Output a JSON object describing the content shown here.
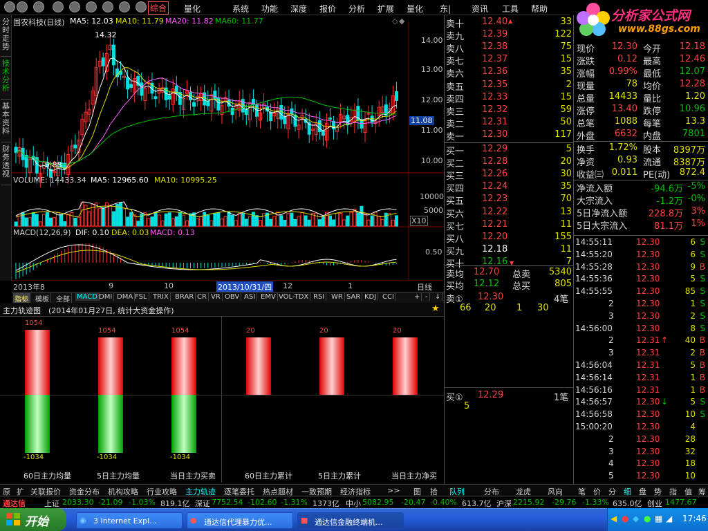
{
  "menubar": {
    "tab_active": "综合",
    "tab2": "量化",
    "items": [
      "系统",
      "功能",
      "深度",
      "报价",
      "分析",
      "扩展",
      "量化",
      "东|",
      "资讯",
      "工具",
      "帮助"
    ]
  },
  "logo": {
    "title": "分析家公式网",
    "url": "www.88gs.com"
  },
  "left_tabs": [
    "分时走势",
    "技术分析",
    "基本资料",
    "财务透视"
  ],
  "chart": {
    "title": "国农科技(日线)",
    "ma5": "MA5: 12.03",
    "ma10": "MA10: 11.79",
    "ma20": "MA20: 11.82",
    "ma60": "MA60: 11.77",
    "high_mark": "14.32",
    "low_mark": "9.88",
    "price_ticks": [
      "14.00",
      "13.00",
      "12.00",
      "11.00",
      "10.00"
    ],
    "current_price_tag": "11.08",
    "volume_label": "VOLUME: 14433.34",
    "vol_ma5": "MA5: 12965.60",
    "vol_ma10": "MA10: 10995.25",
    "vol_ticks": [
      "10000",
      "5000"
    ],
    "vol_unit": "X10",
    "macd_label": "MACD(12,26,9)",
    "dif": "DIF: 0.10",
    "dea": "DEA: 0.03",
    "macd": "MACD: 0.13",
    "macd_tick": "0.50",
    "date_labels": [
      "2013年8",
      "9",
      "10",
      "12",
      "1"
    ],
    "date_cursor": "2013/10/31/四",
    "period": "日线"
  },
  "indicator_tabs": [
    "指标",
    "模板",
    "全部",
    "MACD",
    "DMI",
    "DMA",
    "FSL",
    "TRIX",
    "BRAR",
    "CR",
    "VR",
    "OBV",
    "ASI",
    "EMV",
    "VOL-TDX",
    "RSI",
    "WR",
    "SAR",
    "KDJ",
    "CCI"
  ],
  "indicator_nav": [
    "+",
    "-",
    "↓"
  ],
  "zl": {
    "title": "主力轨迹图",
    "subtitle": "(2014年01月27日, 统计大资金操作)",
    "top_value_a": "1054",
    "bottom_value_a": "-1034",
    "top_value_b": "20",
    "labels": [
      "60日主力均量",
      "5日主力均量",
      "当日主力买卖",
      "60日主力累计",
      "5日主力累计",
      "当日主力净买"
    ]
  },
  "bottom_tabs": [
    "原",
    "扩",
    "关联报价",
    "资金分布",
    "机构攻略",
    "行业攻略",
    "主力轨迹",
    "逐笔委托",
    "热点题材",
    "一致预期",
    "经济指标",
    ">>",
    "图",
    "拾"
  ],
  "orderbook": {
    "sell": [
      {
        "label": "卖十",
        "price": "12.40",
        "vol": "33"
      },
      {
        "label": "卖九",
        "price": "12.39",
        "vol": "122"
      },
      {
        "label": "卖八",
        "price": "12.38",
        "vol": "75"
      },
      {
        "label": "卖七",
        "price": "12.37",
        "vol": "15"
      },
      {
        "label": "卖六",
        "price": "12.36",
        "vol": "35"
      },
      {
        "label": "卖五",
        "price": "12.35",
        "vol": "2"
      },
      {
        "label": "卖四",
        "price": "12.33",
        "vol": "15"
      },
      {
        "label": "卖三",
        "price": "12.32",
        "vol": "59"
      },
      {
        "label": "卖二",
        "price": "12.31",
        "vol": "50"
      },
      {
        "label": "卖一",
        "price": "12.30",
        "vol": "117"
      }
    ],
    "buy": [
      {
        "label": "买一",
        "price": "12.29",
        "vol": "5"
      },
      {
        "label": "买二",
        "price": "12.28",
        "vol": "20"
      },
      {
        "label": "买三",
        "price": "12.26",
        "vol": "30"
      },
      {
        "label": "买四",
        "price": "12.24",
        "vol": "35"
      },
      {
        "label": "买五",
        "price": "12.23",
        "vol": "70"
      },
      {
        "label": "买六",
        "price": "12.22",
        "vol": "13"
      },
      {
        "label": "买七",
        "price": "12.21",
        "vol": "11"
      },
      {
        "label": "买八",
        "price": "12.20",
        "vol": "155"
      },
      {
        "label": "买九",
        "price": "12.18",
        "vol": "11"
      },
      {
        "label": "买十",
        "price": "12.16",
        "vol": "7"
      }
    ],
    "avg_sell_label": "卖均",
    "avg_sell": "12.70",
    "total_sell_label": "总卖",
    "total_sell": "5340",
    "avg_buy_label": "买均",
    "avg_buy": "12.12",
    "total_buy_label": "总买",
    "total_buy": "805"
  },
  "queue": {
    "sell_label": "卖①",
    "sell_price": "12.30",
    "sell_count": "4笔",
    "sell_vols": [
      "66",
      "20",
      "1",
      "30"
    ],
    "buy_label": "买①",
    "buy_price": "12.29",
    "buy_count": "1笔",
    "buy_vols": [
      "5"
    ]
  },
  "quote": {
    "rows": [
      {
        "l1": "现价",
        "v1": "12.30",
        "l2": "今开",
        "v2": "12.18"
      },
      {
        "l1": "涨跌",
        "v1": "0.12",
        "l2": "最高",
        "v2": "12.46"
      },
      {
        "l1": "涨幅",
        "v1": "0.99%",
        "l2": "最低",
        "v2": "12.07"
      },
      {
        "l1": "现量",
        "v1": "78",
        "l2": "均价",
        "v2": "12.28"
      },
      {
        "l1": "总量",
        "v1": "14433",
        "l2": "量比",
        "v2": "1.20"
      },
      {
        "l1": "涨停",
        "v1": "13.40",
        "l2": "跌停",
        "v2": "10.96"
      },
      {
        "l1": "总笔",
        "v1": "1088",
        "l2": "每笔",
        "v2": "13.3"
      },
      {
        "l1": "外盘",
        "v1": "6632",
        "l2": "内盘",
        "v2": "7801"
      }
    ],
    "rows2": [
      {
        "l1": "换手",
        "v1": "1.72%",
        "l2": "股本",
        "v2": "8397万"
      },
      {
        "l1": "净资",
        "v1": "0.93",
        "l2": "流通",
        "v2": "8387万"
      },
      {
        "l1": "收益㈢",
        "v1": "0.011",
        "l2": "PE(动)",
        "v2": "872.4"
      }
    ],
    "flows": [
      {
        "l": "净流入额",
        "v": "-94.6万",
        "p": "-5%"
      },
      {
        "l": "大宗流入",
        "v": "-1.2万",
        "p": "-0%"
      },
      {
        "l": "5日净流入额",
        "v": "228.8万",
        "p": "3%"
      },
      {
        "l": "5日大宗流入",
        "v": "81.1万",
        "p": "1%"
      }
    ]
  },
  "ticks": [
    {
      "t": "14:55:11",
      "p": "12.30",
      "a": "",
      "v": "6",
      "s": "S"
    },
    {
      "t": "14:55:20",
      "p": "12.30",
      "a": "",
      "v": "6",
      "s": "S"
    },
    {
      "t": "14:55:28",
      "p": "12.30",
      "a": "",
      "v": "9",
      "s": "B"
    },
    {
      "t": "14:55:36",
      "p": "12.30",
      "a": "",
      "v": "5",
      "s": "S"
    },
    {
      "t": "14:55:55",
      "p": "12.30",
      "a": "",
      "v": "85",
      "s": "S"
    },
    {
      "t": "2",
      "p": "12.30",
      "a": "",
      "v": "1",
      "s": "S"
    },
    {
      "t": "3",
      "p": "12.30",
      "a": "",
      "v": "2",
      "s": "S"
    },
    {
      "t": "14:56:00",
      "p": "12.30",
      "a": "",
      "v": "8",
      "s": "S"
    },
    {
      "t": "2",
      "p": "12.31",
      "a": "↑",
      "v": "40",
      "s": "B"
    },
    {
      "t": "3",
      "p": "12.31",
      "a": "",
      "v": "2",
      "s": "B"
    },
    {
      "t": "14:56:04",
      "p": "12.31",
      "a": "",
      "v": "5",
      "s": "B"
    },
    {
      "t": "14:56:14",
      "p": "12.31",
      "a": "",
      "v": "1",
      "s": "B"
    },
    {
      "t": "14:56:16",
      "p": "12.31",
      "a": "",
      "v": "1",
      "s": "B"
    },
    {
      "t": "14:56:57",
      "p": "12.30",
      "a": "↓",
      "v": "5",
      "s": "S"
    },
    {
      "t": "14:56:58",
      "p": "12.30",
      "a": "",
      "v": "10",
      "s": "S"
    },
    {
      "t": "15:00:20",
      "p": "12.30",
      "a": "",
      "v": "4",
      "s": ""
    },
    {
      "t": "2",
      "p": "12.30",
      "a": "",
      "v": "28",
      "s": ""
    },
    {
      "t": "3",
      "p": "12.30",
      "a": "",
      "v": "32",
      "s": ""
    },
    {
      "t": "4",
      "p": "12.30",
      "a": "",
      "v": "18",
      "s": ""
    },
    {
      "t": "5",
      "p": "12.30",
      "a": "",
      "v": "10",
      "s": ""
    }
  ],
  "right_tabs": [
    "队列",
    "分布",
    "龙虎",
    "风向",
    "笔",
    "价",
    "分",
    "细",
    "盘",
    "势",
    "指",
    "值",
    "筹"
  ],
  "statusbar": {
    "brand": "通达信",
    "sh_label": "上证",
    "sh_val": "2033.30",
    "sh_chg": "-21.09",
    "sh_pct": "-1.03%",
    "sh_amt": "819.1亿",
    "sz_label": "深证",
    "sz_val": "7752.54",
    "sz_chg": "-102.60",
    "sz_pct": "-1.31%",
    "sz_amt": "1373亿",
    "zx_label": "中小",
    "zx_val": "5082.95",
    "zx_chg": "-20.47",
    "zx_pct": "-0.40%",
    "zx_amt": "613.7亿",
    "hs_label": "沪深",
    "hs_val": "2215.92",
    "hs_chg": "-29.76",
    "hs_pct": "-1.33%",
    "hs_amt": "635.0亿",
    "cy_label": "创业",
    "cy_val": "1477.67"
  },
  "taskbar": {
    "start": "开始",
    "tasks": [
      "3 Internet Expl...",
      "通达信代理暴力优...",
      "通达信金融终端机..."
    ],
    "clock": "17:46"
  },
  "colors": {
    "up": "#ff4040",
    "down": "#00c000",
    "yellow": "#e0e000",
    "cyan": "#00ffff"
  }
}
